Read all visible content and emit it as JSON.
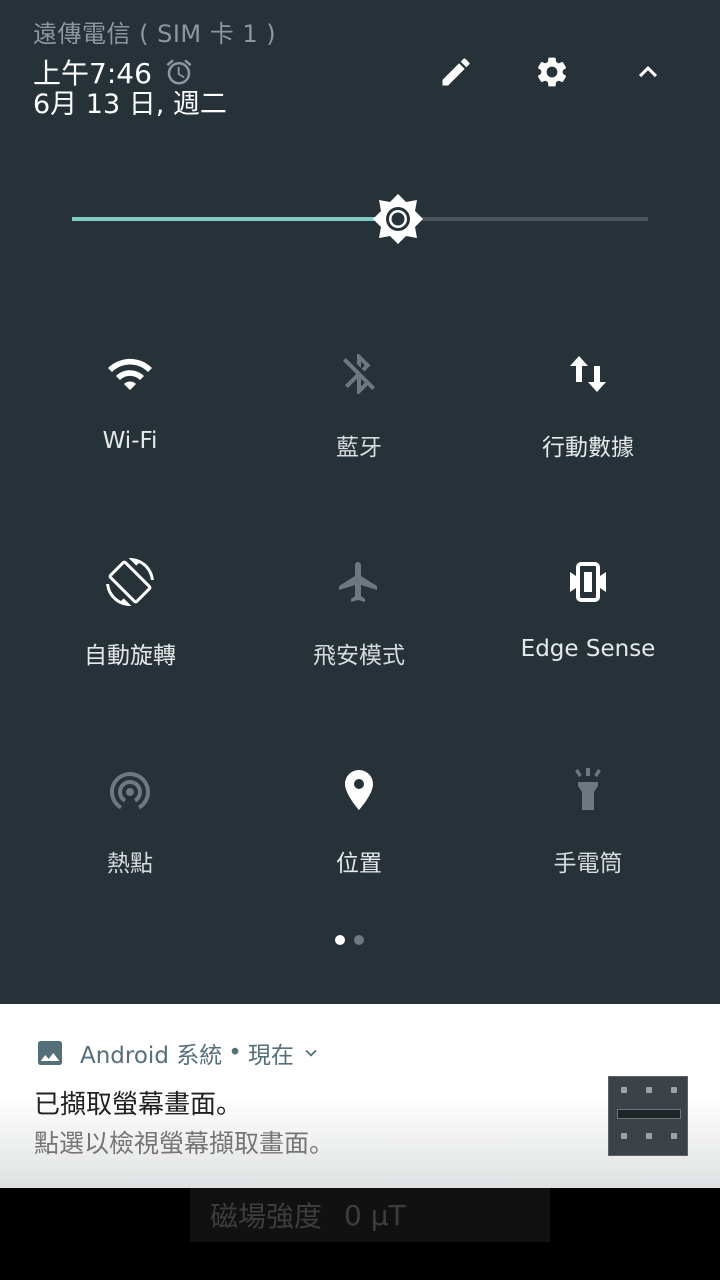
{
  "status": {
    "carrier": "遠傳電信 ( SIM 卡 1 )",
    "time": "上午7:46",
    "date": "6月 13 日, 週二",
    "alarm_icon": "alarm-clock-icon"
  },
  "header_actions": [
    {
      "name": "edit-button",
      "icon": "pencil-icon"
    },
    {
      "name": "settings-button",
      "icon": "gear-icon"
    },
    {
      "name": "collapse-button",
      "icon": "chevron-up-icon"
    }
  ],
  "brightness": {
    "level": 0.566,
    "icon": "brightness-icon"
  },
  "tiles": [
    {
      "label": "Wi-Fi",
      "icon": "wifi-icon",
      "active": true
    },
    {
      "label": "藍牙",
      "icon": "bluetooth-off-icon",
      "active": false
    },
    {
      "label": "行動數據",
      "icon": "mobile-data-icon",
      "active": true
    },
    {
      "label": "自動旋轉",
      "icon": "auto-rotate-icon",
      "active": true
    },
    {
      "label": "飛安模式",
      "icon": "airplane-icon",
      "active": false
    },
    {
      "label": "Edge Sense",
      "icon": "edge-sense-icon",
      "active": true
    },
    {
      "label": "熱點",
      "icon": "hotspot-icon",
      "active": false
    },
    {
      "label": "位置",
      "icon": "location-icon",
      "active": true
    },
    {
      "label": "手電筒",
      "icon": "flashlight-icon",
      "active": false
    }
  ],
  "pager": {
    "pages": 2,
    "current": 1
  },
  "notification": {
    "app": "Android 系統",
    "separator": "•",
    "when": "現在",
    "title": "已擷取螢幕畫面。",
    "text": "點選以檢視螢幕擷取畫面。",
    "app_icon": "image-icon",
    "expand_icon": "chevron-down-icon"
  },
  "background_app": {
    "label": "磁場強度",
    "value": "0 μT"
  },
  "colors": {
    "shade_bg": "#263238",
    "accent": "#80cbc4",
    "inactive_icon": "#6e787e"
  }
}
